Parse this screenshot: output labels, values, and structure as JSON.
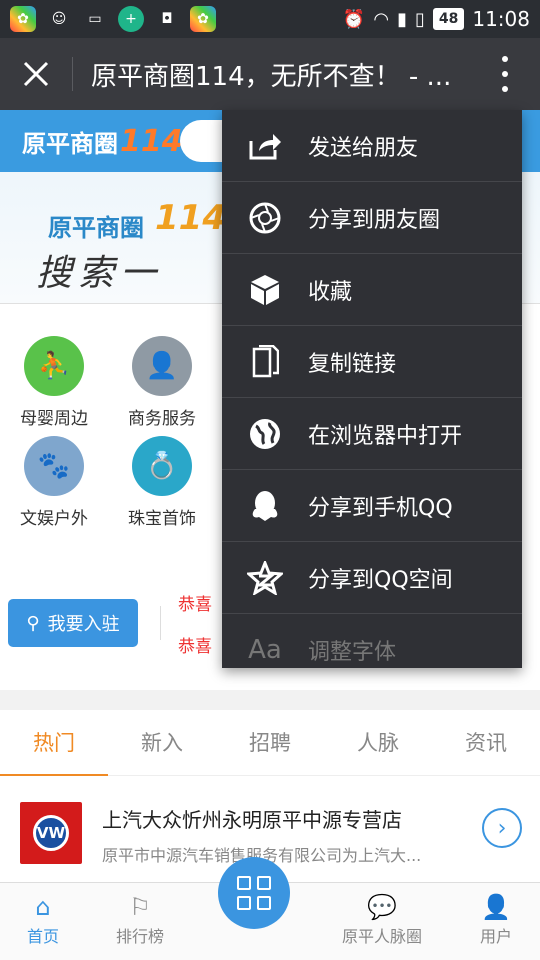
{
  "status_bar": {
    "battery": "48",
    "time": "11:08"
  },
  "title_bar": {
    "title": "原平商圈114，无所不查！ - ..."
  },
  "page": {
    "logo_text": "原平商圈",
    "logo_num": "114",
    "hero_title": "原平商圈",
    "hero_num": "114",
    "hero_slogan": "搜索一",
    "categories": [
      {
        "label": "母婴周边",
        "color": "#59c24a"
      },
      {
        "label": "商务服务",
        "color": "#8f9aa4"
      },
      {
        "label": "文娱户外",
        "color": "#7fa6cd"
      },
      {
        "label": "珠宝首饰",
        "color": "#2aa7c9"
      }
    ],
    "join_label": "我要入驻",
    "congrats": [
      "恭喜",
      "恭喜"
    ],
    "tabs": [
      "热门",
      "新入",
      "招聘",
      "人脉",
      "资讯"
    ],
    "listing": {
      "title": "上汽大众忻州永明原平中源专营店",
      "desc": "原平市中源汽车销售服务有限公司为上汽大..."
    },
    "nav": [
      "首页",
      "排行榜",
      "原平人脉圈",
      "用户"
    ]
  },
  "menu": {
    "items": [
      {
        "label": "发送给朋友",
        "icon": "share-out-icon"
      },
      {
        "label": "分享到朋友圈",
        "icon": "aperture-icon"
      },
      {
        "label": "收藏",
        "icon": "cube-icon"
      },
      {
        "label": "复制链接",
        "icon": "copy-icon"
      },
      {
        "label": "在浏览器中打开",
        "icon": "globe-icon"
      },
      {
        "label": "分享到手机QQ",
        "icon": "qq-icon"
      },
      {
        "label": "分享到QQ空间",
        "icon": "qzone-star-icon"
      },
      {
        "label": "调整字体",
        "icon": "font-icon"
      }
    ]
  }
}
